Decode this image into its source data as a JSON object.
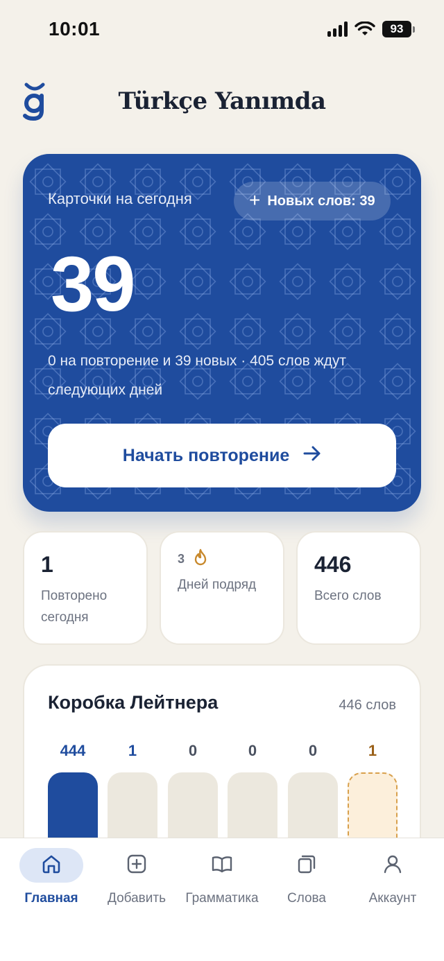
{
  "status_bar": {
    "time": "10:01",
    "battery": "93"
  },
  "header": {
    "title": "Türkçe Yanımda",
    "logo_glyph": "ğ"
  },
  "hero": {
    "label": "Карточки на сегодня",
    "new_words": "Новых слов: 39",
    "count": "39",
    "description": "0 на повторение и 39 новых · 405 слов ждут следующих дней",
    "start_label": "Начать повторение",
    "color": "#1f4c9e"
  },
  "stats": {
    "reviewed": {
      "value": "1",
      "label": "Повторено сегодня"
    },
    "streak": {
      "value": "3",
      "label": "Дней подряд",
      "icon": "flame-icon"
    },
    "total": {
      "value": "446",
      "label": "Всего слов"
    }
  },
  "leitner": {
    "title": "Коробка Лейтнера",
    "total": "446 слов",
    "boxes": [
      {
        "count": "444",
        "state": "filled"
      },
      {
        "count": "1",
        "state": "light"
      },
      {
        "count": "0",
        "state": "empty"
      },
      {
        "count": "0",
        "state": "empty"
      },
      {
        "count": "0",
        "state": "empty"
      },
      {
        "count": "1",
        "state": "final"
      }
    ]
  },
  "nav": {
    "items": [
      {
        "label": "Главная",
        "icon": "home-icon",
        "active": true
      },
      {
        "label": "Добавить",
        "icon": "add-square-icon",
        "active": false
      },
      {
        "label": "Грамматика",
        "icon": "book-icon",
        "active": false
      },
      {
        "label": "Слова",
        "icon": "cards-icon",
        "active": false
      },
      {
        "label": "Аккаунт",
        "icon": "user-icon",
        "active": false
      }
    ]
  },
  "colors": {
    "primary": "#1f4c9e",
    "accent": "#c8892d",
    "background": "#f4f1ea"
  }
}
